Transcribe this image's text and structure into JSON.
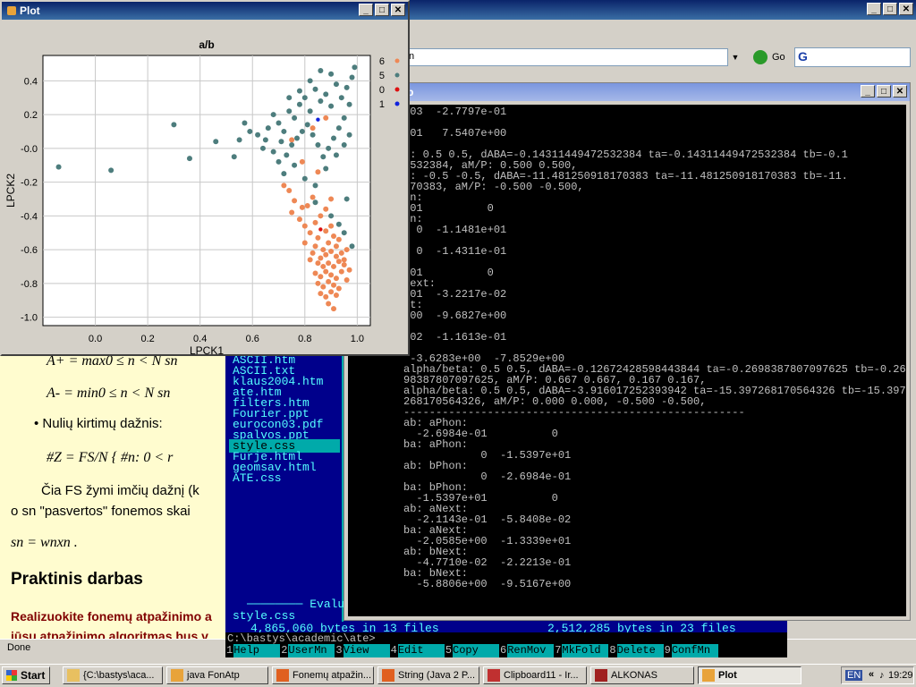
{
  "browser": {
    "url_suffix": "n",
    "go_label": "Go",
    "status": "Done",
    "doc": {
      "formula_max": "A+  =  max0 ≤ n < N sn",
      "formula_min": "A-  =  min0 ≤ n < N sn",
      "bullet": "Nulių kirtimų dažnis:",
      "formula_z": "#Z  =  FS/N { #n: 0 < r",
      "para1": "Čia FS žymi imčių dažnį (k",
      "para2": "o sn \"pasvertos\" fonemos skai",
      "formula_s": "sn  =  wnxn .",
      "heading": "Praktinis darbas",
      "task1": "Realizuokite fonemų atpažinimo a",
      "task2": "jūsų atpažinimo algoritmas bus v"
    }
  },
  "far": {
    "files": [
      "ASCII.htm",
      "ASCII.txt",
      "klaus2004.htm",
      "ate.htm",
      "filters.htm",
      "Fourier.ppt",
      "eurocon03.pdf",
      "spalvos.ppt",
      "style.css",
      "Furje.html",
      "geomsav.html",
      "ATE.css"
    ],
    "selected_index": 8,
    "evalua_label": "Evalua",
    "current_file": "style.css",
    "left_bytes": "4,865,060 bytes in 13 files",
    "right_bytes": "2,512,285 bytes in 23 files",
    "cmd_prompt": "C:\\bastys\\academic\\ate>",
    "keys": [
      {
        "n": "1",
        "l": "Help"
      },
      {
        "n": "2",
        "l": "UserMn"
      },
      {
        "n": "3",
        "l": "View"
      },
      {
        "n": "4",
        "l": "Edit"
      },
      {
        "n": "5",
        "l": "Copy"
      },
      {
        "n": "6",
        "l": "RenMov"
      },
      {
        "n": "7",
        "l": "MkFold"
      },
      {
        "n": "8",
        "l": "Delete"
      },
      {
        "n": "9",
        "l": "ConfMn"
      }
    ]
  },
  "console": {
    "title_suffix": "tp",
    "text": "-03  -2.7797e-01\n\n+01   7.5407e+00\n\na: 0.5 0.5, dABA=-0.14311449472532384 ta=-0.14311449472532384 tb=-0.1\n2532384, aM/P: 0.500 0.500,\na: -0.5 -0.5, dABA=-11.481250918170383 ta=-11.481250918170383 tb=-11.\n170383, aM/P: -0.500 -0.500,\non:\n-01          0\non:\n  0  -1.1481e+01\n\n  0  -1.4311e-01\n\n+01          0\nNext:\n-01  -3.2217e-02\nxt:\n+00  -9.6827e+00\n\n-02  -1.1613e-01\n\n -3.6283e+00  -7.8529e+00\nalpha/beta: 0.5 0.5, dABA=-0.12672428598443844 ta=-0.2698387807097625 tb=-0.26\n98387807097625, aM/P: 0.667 0.667, 0.167 0.167,\nalpha/beta: 0.5 0.5, dABA=-3.916017252393942 ta=-15.397268170564326 tb=-15.397\n268170564326, aM/P: 0.000 0.000, -0.500 -0.500,\n-----------------------------------------------------\nab: aPhon:\n  -2.6984e-01          0\nba: aPhon:\n            0  -1.5397e+01\nab: bPhon:\n            0  -2.6984e-01\nba: bPhon:\n  -1.5397e+01          0\nab: aNext:\n  -2.1143e-01  -5.8408e-02\nba: aNext:\n  -2.0585e+00  -1.3339e+01\nab: bNext:\n  -4.7710e-02  -2.2213e-01\nba: bNext:\n  -5.8806e+00  -9.5167e+00"
  },
  "plot": {
    "window_title": "Plot",
    "chart_data": {
      "type": "scatter",
      "title": "a/b",
      "xlabel": "LPCK1",
      "ylabel": "LPCK2",
      "xlim": [
        -0.2,
        1.05
      ],
      "ylim": [
        -1.05,
        0.55
      ],
      "xticks": [
        "0.0",
        "0.2",
        "0.4",
        "0.6",
        "0.8",
        "1.0"
      ],
      "xtick_values": [
        0.0,
        0.2,
        0.4,
        0.6,
        0.8,
        1.0
      ],
      "yticks": [
        "0.4",
        "0.2",
        "-0.0",
        "-0.2",
        "-0.4",
        "-0.6",
        "-0.8",
        "-1.0"
      ],
      "ytick_values": [
        0.4,
        0.2,
        0.0,
        -0.2,
        -0.4,
        -0.6,
        -0.8,
        -1.0
      ],
      "grid": true,
      "legend_position": "right",
      "series": [
        {
          "name": "6",
          "color": "#ee8855",
          "points": [
            [
              0.72,
              -0.22
            ],
            [
              0.74,
              -0.25
            ],
            [
              0.76,
              -0.31
            ],
            [
              0.79,
              -0.35
            ],
            [
              0.75,
              -0.38
            ],
            [
              0.81,
              -0.34
            ],
            [
              0.83,
              -0.29
            ],
            [
              0.78,
              -0.42
            ],
            [
              0.8,
              -0.46
            ],
            [
              0.84,
              -0.44
            ],
            [
              0.86,
              -0.4
            ],
            [
              0.88,
              -0.36
            ],
            [
              0.82,
              -0.5
            ],
            [
              0.85,
              -0.53
            ],
            [
              0.88,
              -0.49
            ],
            [
              0.9,
              -0.46
            ],
            [
              0.91,
              -0.52
            ],
            [
              0.84,
              -0.58
            ],
            [
              0.87,
              -0.6
            ],
            [
              0.89,
              -0.56
            ],
            [
              0.92,
              -0.58
            ],
            [
              0.93,
              -0.54
            ],
            [
              0.83,
              -0.62
            ],
            [
              0.86,
              -0.65
            ],
            [
              0.88,
              -0.63
            ],
            [
              0.9,
              -0.61
            ],
            [
              0.92,
              -0.64
            ],
            [
              0.94,
              -0.62
            ],
            [
              0.85,
              -0.68
            ],
            [
              0.87,
              -0.7
            ],
            [
              0.89,
              -0.68
            ],
            [
              0.91,
              -0.7
            ],
            [
              0.93,
              -0.67
            ],
            [
              0.95,
              -0.69
            ],
            [
              0.84,
              -0.74
            ],
            [
              0.86,
              -0.76
            ],
            [
              0.88,
              -0.73
            ],
            [
              0.9,
              -0.75
            ],
            [
              0.92,
              -0.77
            ],
            [
              0.94,
              -0.73
            ],
            [
              0.85,
              -0.8
            ],
            [
              0.87,
              -0.82
            ],
            [
              0.89,
              -0.79
            ],
            [
              0.91,
              -0.81
            ],
            [
              0.93,
              -0.83
            ],
            [
              0.96,
              -0.78
            ],
            [
              0.86,
              -0.86
            ],
            [
              0.88,
              -0.88
            ],
            [
              0.9,
              -0.85
            ],
            [
              0.92,
              -0.87
            ],
            [
              0.89,
              -0.92
            ],
            [
              0.91,
              -0.95
            ],
            [
              0.95,
              -0.66
            ],
            [
              0.97,
              -0.72
            ],
            [
              0.8,
              -0.56
            ],
            [
              0.82,
              -0.66
            ],
            [
              0.96,
              -0.6
            ],
            [
              0.75,
              0.05
            ],
            [
              0.83,
              0.12
            ],
            [
              0.88,
              0.18
            ],
            [
              0.85,
              -0.14
            ],
            [
              0.79,
              -0.08
            ],
            [
              0.9,
              -0.3
            ]
          ]
        },
        {
          "name": "5",
          "color": "#4d7d7d",
          "points": [
            [
              -0.14,
              -0.11
            ],
            [
              0.06,
              -0.13
            ],
            [
              0.3,
              0.14
            ],
            [
              0.36,
              -0.06
            ],
            [
              0.46,
              0.04
            ],
            [
              0.53,
              -0.05
            ],
            [
              0.55,
              0.05
            ],
            [
              0.57,
              0.15
            ],
            [
              0.59,
              0.1
            ],
            [
              0.62,
              0.08
            ],
            [
              0.64,
              0.0
            ],
            [
              0.66,
              0.12
            ],
            [
              0.68,
              0.2
            ],
            [
              0.7,
              0.15
            ],
            [
              0.72,
              0.1
            ],
            [
              0.74,
              0.22
            ],
            [
              0.76,
              0.18
            ],
            [
              0.78,
              0.26
            ],
            [
              0.8,
              0.3
            ],
            [
              0.82,
              0.22
            ],
            [
              0.84,
              0.35
            ],
            [
              0.86,
              0.28
            ],
            [
              0.88,
              0.32
            ],
            [
              0.9,
              0.25
            ],
            [
              0.92,
              0.38
            ],
            [
              0.94,
              0.3
            ],
            [
              0.96,
              0.36
            ],
            [
              0.98,
              0.42
            ],
            [
              0.99,
              0.48
            ],
            [
              0.97,
              0.26
            ],
            [
              0.95,
              0.18
            ],
            [
              0.93,
              0.12
            ],
            [
              0.91,
              0.06
            ],
            [
              0.89,
              0.0
            ],
            [
              0.87,
              -0.05
            ],
            [
              0.85,
              0.02
            ],
            [
              0.83,
              0.08
            ],
            [
              0.81,
              0.14
            ],
            [
              0.79,
              0.1
            ],
            [
              0.77,
              0.06
            ],
            [
              0.75,
              0.02
            ],
            [
              0.73,
              -0.04
            ],
            [
              0.71,
              0.04
            ],
            [
              0.7,
              -0.08
            ],
            [
              0.68,
              -0.02
            ],
            [
              0.72,
              -0.15
            ],
            [
              0.76,
              -0.1
            ],
            [
              0.8,
              -0.18
            ],
            [
              0.84,
              -0.22
            ],
            [
              0.88,
              -0.12
            ],
            [
              0.92,
              -0.04
            ],
            [
              0.95,
              0.02
            ],
            [
              0.97,
              0.08
            ],
            [
              0.9,
              0.44
            ],
            [
              0.86,
              0.46
            ],
            [
              0.82,
              0.4
            ],
            [
              0.78,
              0.34
            ],
            [
              0.84,
              -0.32
            ],
            [
              0.9,
              -0.4
            ],
            [
              0.95,
              -0.5
            ],
            [
              0.98,
              -0.58
            ],
            [
              0.93,
              -0.45
            ],
            [
              0.96,
              -0.3
            ],
            [
              0.74,
              0.3
            ],
            [
              0.65,
              0.05
            ]
          ]
        },
        {
          "name": "0",
          "color": "#dd1111",
          "points": [
            [
              0.86,
              -0.48
            ]
          ]
        },
        {
          "name": "1",
          "color": "#1122dd",
          "points": [
            [
              0.85,
              0.17
            ]
          ]
        }
      ]
    }
  },
  "taskbar": {
    "start": "Start",
    "tasks": [
      "{C:\\bastys\\aca...",
      "java FonAtp",
      "Fonemų atpažin...",
      "String (Java 2 P...",
      "Clipboard11 - Ir...",
      "ALKONAS",
      "Plot"
    ],
    "lang": "EN",
    "clock": "19:29"
  }
}
